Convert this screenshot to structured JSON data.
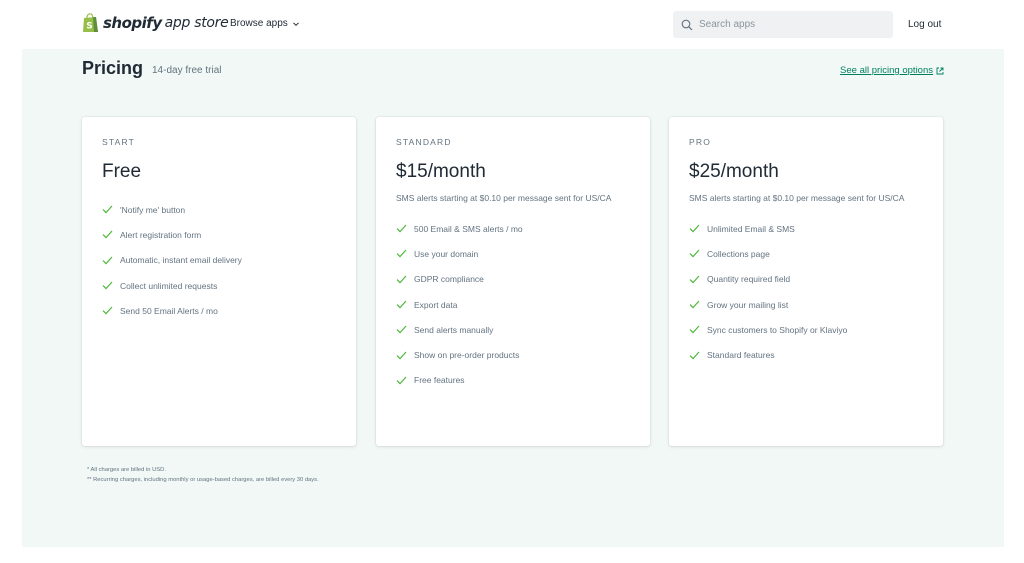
{
  "header": {
    "logo_brand": "shopify",
    "logo_suffix": "app store",
    "browse_label": "Browse apps",
    "search_placeholder": "Search apps",
    "logout_label": "Log out"
  },
  "pricing": {
    "title": "Pricing",
    "trial": "14-day free trial",
    "see_all_label": "See all pricing options"
  },
  "plans": [
    {
      "tier": "START",
      "price": "Free",
      "description": "",
      "features": [
        "'Notify me' button",
        "Alert registration form",
        "Automatic, instant email delivery",
        "Collect unlimited requests",
        "Send 50 Email Alerts / mo"
      ]
    },
    {
      "tier": "STANDARD",
      "price": "$15/month",
      "description": "SMS alerts starting at $0.10 per message sent for US/CA",
      "features": [
        "500 Email & SMS alerts / mo",
        "Use your domain",
        "GDPR compliance",
        "Export data",
        "Send alerts manually",
        "Show on pre-order products",
        "Free features"
      ]
    },
    {
      "tier": "PRO",
      "price": "$25/month",
      "description": "SMS alerts starting at $0.10 per message sent for US/CA",
      "features": [
        "Unlimited Email & SMS",
        "Collections page",
        "Quantity required field",
        "Grow your mailing list",
        "Sync customers to Shopify or Klaviyo",
        "Standard features"
      ]
    }
  ],
  "footnotes": [
    "* All charges are billed in USD.",
    "** Recurring charges, including monthly or usage-based charges, are billed every 30 days."
  ],
  "colors": {
    "accent": "#007f5f",
    "check": "#50b83c",
    "background": "#f1f8f5",
    "logo_green": "#95bf47"
  },
  "icons": {
    "logo": "shopify-bag-icon",
    "browse": "chevron-down-icon",
    "search": "search-icon",
    "external": "external-link-icon",
    "feature": "checkmark-icon"
  }
}
